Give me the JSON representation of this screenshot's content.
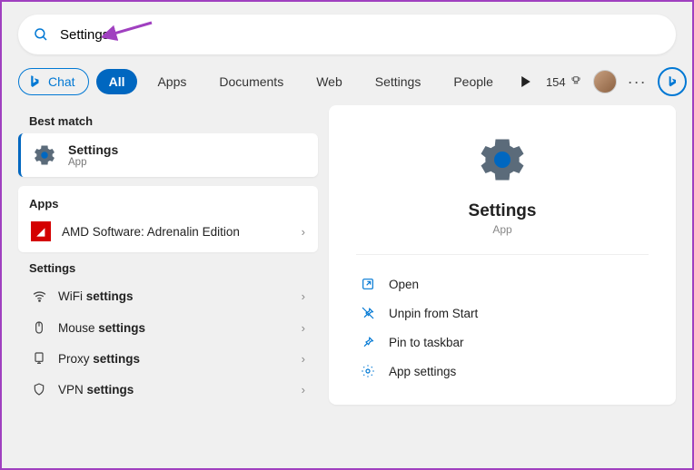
{
  "search": {
    "value": "Settings"
  },
  "filters": {
    "chat": "Chat",
    "all": "All",
    "apps": "Apps",
    "documents": "Documents",
    "web": "Web",
    "settings": "Settings",
    "people": "People"
  },
  "points": "154",
  "left": {
    "best_match_header": "Best match",
    "best_match": {
      "title": "Settings",
      "subtitle": "App"
    },
    "apps_header": "Apps",
    "apps": [
      {
        "name": "AMD Software: Adrenalin Edition"
      }
    ],
    "settings_header": "Settings",
    "settings_rows": [
      {
        "pre": "WiFi ",
        "bold": "settings"
      },
      {
        "pre": "Mouse ",
        "bold": "settings"
      },
      {
        "pre": "Proxy ",
        "bold": "settings"
      },
      {
        "pre": "VPN ",
        "bold": "settings"
      }
    ]
  },
  "right": {
    "title": "Settings",
    "subtitle": "App",
    "actions": [
      {
        "icon": "open",
        "label": "Open"
      },
      {
        "icon": "unpin",
        "label": "Unpin from Start"
      },
      {
        "icon": "pin",
        "label": "Pin to taskbar"
      },
      {
        "icon": "gear",
        "label": "App settings"
      }
    ]
  }
}
